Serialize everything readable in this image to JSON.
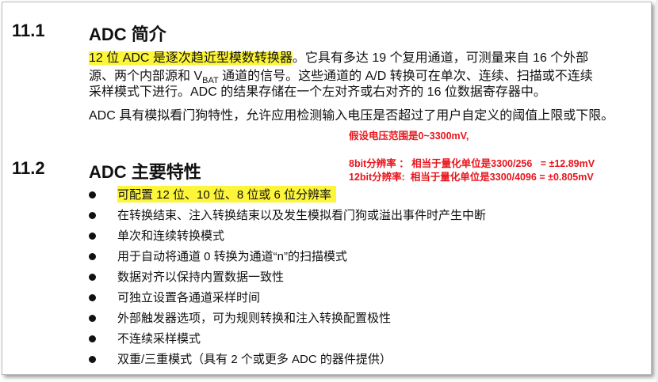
{
  "sec1": {
    "num": "11.1",
    "title": "ADC 简介",
    "lines": [
      {
        "hl": "12 位 ADC 是逐次趋近型模数转换器",
        "rest": "。它具有多达 19 个复用通道，可测量来自 16 个外部"
      },
      {
        "a": "源、两个内部源和 V",
        "sub": "BAT",
        "b": " 通道的信号。这些通道的 A/D 转换可在单次、连续、扫描或不连续"
      },
      {
        "text": "采样模式下进行。ADC 的结果存储在一个左对齐或右对齐的 16 位数据寄存器中。"
      }
    ],
    "para2": "ADC 具有模拟看门狗特性，允许应用检测输入电压是否超过了用户自定义的阈值上限或下限。"
  },
  "notes": {
    "range": "假设电压范围是0~3300mV,",
    "n8": "8bit分辨率 ： 相当于量化单位是3300/256   = ±12.89mV",
    "n12": "12bit分辨率:  相当于量化单位是3300/4096 = ±0.805mV"
  },
  "sec2": {
    "num": "11.2",
    "title": "ADC 主要特性",
    "items": [
      "可配置 12 位、10 位、8 位或 6 位分辨率",
      "在转换结束、注入转换结束以及发生模拟看门狗或溢出事件时产生中断",
      "单次和连续转换模式",
      "用于自动将通道 0 转换为通道“n”的扫描模式",
      "数据对齐以保持内置数据一致性",
      "可独立设置各通道采样时间",
      "外部触发器选项，可为规则转换和注入转换配置极性",
      "不连续采样模式",
      "双重/三重模式（具有 2 个或更多 ADC 的器件提供）"
    ]
  }
}
